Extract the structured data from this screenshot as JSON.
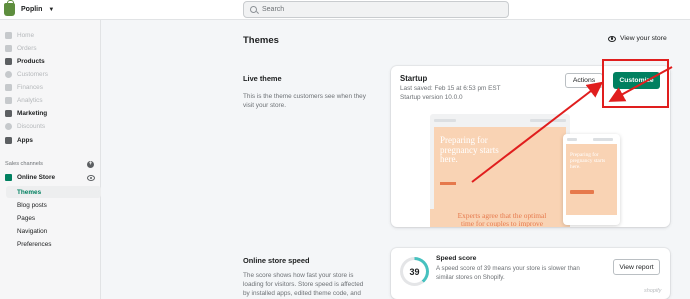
{
  "topbar": {
    "store_name": "Poplin",
    "search_placeholder": "Search"
  },
  "sidebar": {
    "items": [
      {
        "label": "Home",
        "state": "dim",
        "icon": "home-icon"
      },
      {
        "label": "Orders",
        "state": "dim",
        "icon": "orders-icon"
      },
      {
        "label": "Products",
        "state": "bold",
        "icon": "products-icon"
      },
      {
        "label": "Customers",
        "state": "dim",
        "icon": "customers-icon"
      },
      {
        "label": "Finances",
        "state": "dim",
        "icon": "finances-icon"
      },
      {
        "label": "Analytics",
        "state": "dim",
        "icon": "analytics-icon"
      },
      {
        "label": "Marketing",
        "state": "bold",
        "icon": "marketing-icon"
      },
      {
        "label": "Discounts",
        "state": "dim",
        "icon": "discounts-icon"
      },
      {
        "label": "Apps",
        "state": "bold",
        "icon": "apps-icon"
      }
    ],
    "sales_channels_label": "Sales channels",
    "online_store_label": "Online Store",
    "sub_items": [
      "Themes",
      "Blog posts",
      "Pages",
      "Navigation",
      "Preferences"
    ]
  },
  "main": {
    "title": "Themes",
    "view_store_label": "View your store",
    "live_theme": {
      "heading": "Live theme",
      "description": "This is the theme customers see when they visit your store.",
      "theme_name": "Startup",
      "last_saved": "Last saved: Feb 15 at 6:53 pm EST",
      "version": "Startup version 10.0.0",
      "actions_label": "Actions",
      "customize_label": "Customize",
      "preview_hero_text": "Preparing for pregnancy starts here.",
      "preview_lower_text": "Experts agree that the optimal time for couples to improve their",
      "preview_mobile_text": "Preparing for pregnancy starts here."
    },
    "speed": {
      "heading": "Online store speed",
      "description": "The score shows how fast your store is loading for visitors. Store speed is affected by installed apps, edited theme code, and",
      "score": "39",
      "score_fraction": 0.39,
      "score_title": "Speed score",
      "score_desc": "A speed score of 39 means your store is slower than similar stores on Shopify.",
      "view_report_label": "View report"
    }
  },
  "colors": {
    "accent": "#008060",
    "annotation": "#e01e1e",
    "preview_peach": "#f9d3b4",
    "preview_orange": "#e6794c",
    "speed_ring": "#47c1bf"
  }
}
